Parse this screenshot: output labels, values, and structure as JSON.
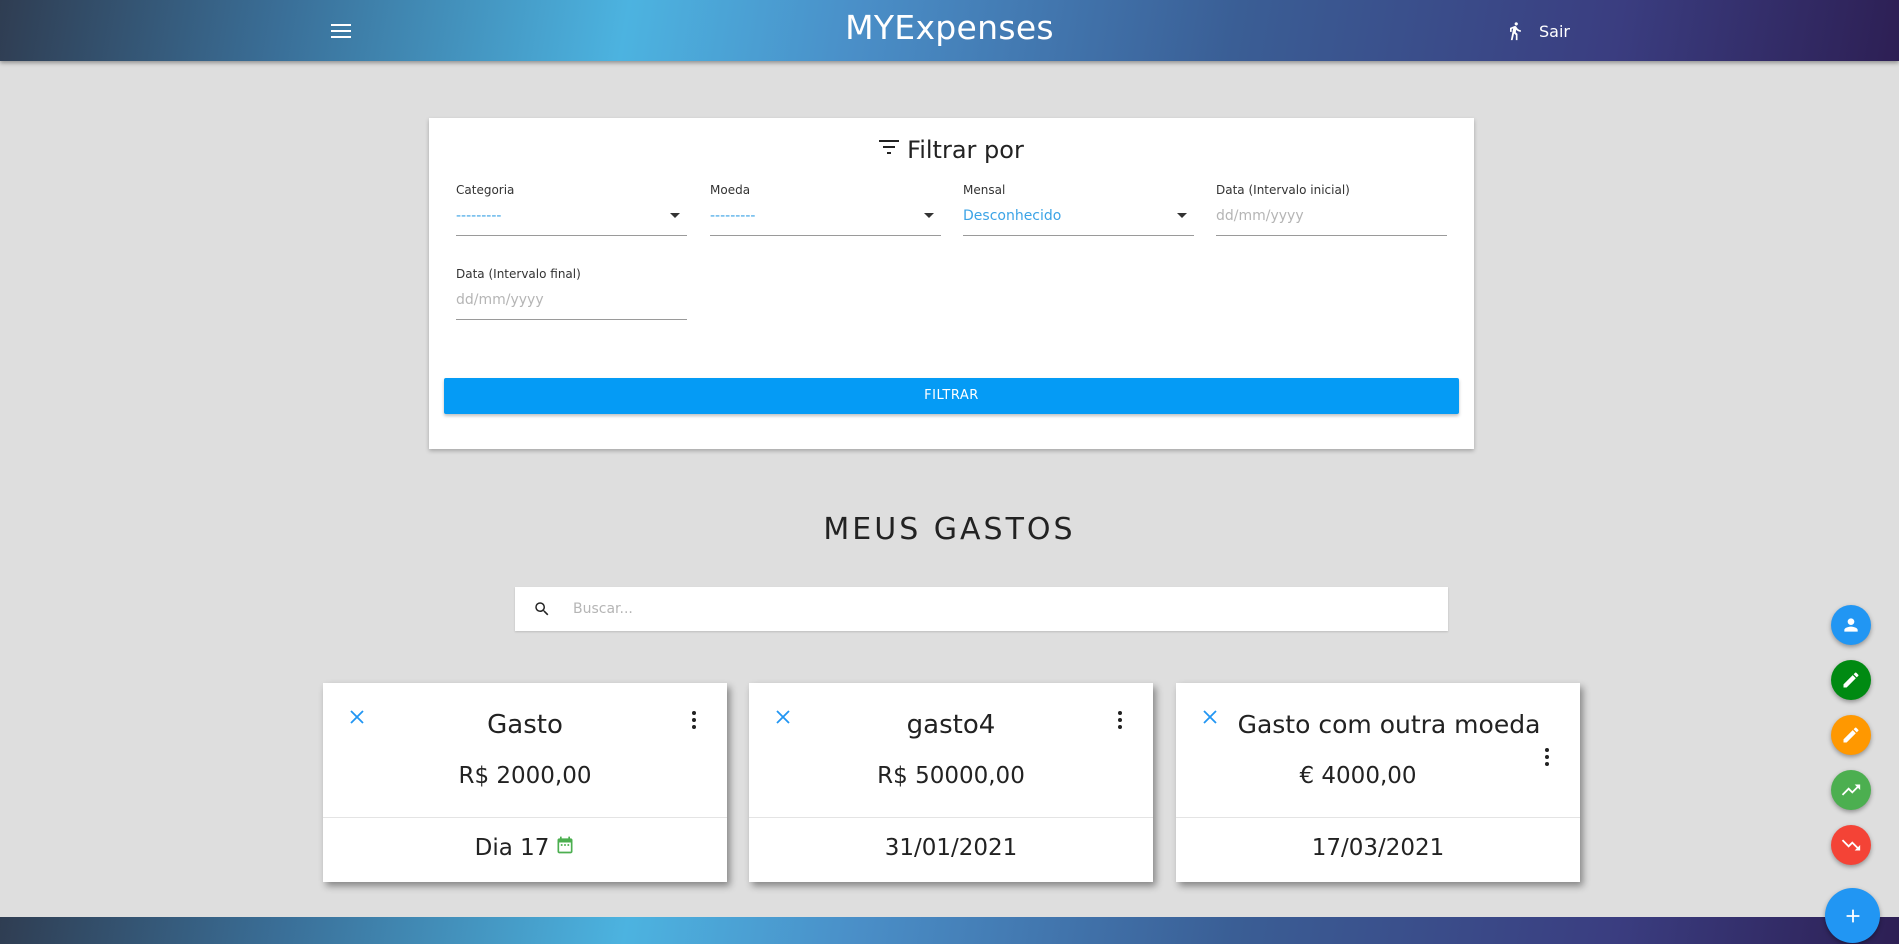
{
  "header": {
    "title": "MYExpenses",
    "logout_label": "Sair",
    "menu_icon": "menu-icon",
    "logout_icon": "walking-person-icon"
  },
  "filter": {
    "title": "Filtrar por",
    "fields": {
      "categoria": {
        "label": "Categoria",
        "value": "---------"
      },
      "moeda": {
        "label": "Moeda",
        "value": "---------"
      },
      "mensal": {
        "label": "Mensal",
        "value": "Desconhecido"
      },
      "data_inicial": {
        "label": "Data (Intervalo inicial)",
        "placeholder": "dd/mm/yyyy"
      },
      "data_final": {
        "label": "Data (Intervalo final)",
        "placeholder": "dd/mm/yyyy"
      }
    },
    "button_label": "FILTRAR"
  },
  "expenses": {
    "title": "MEUS GASTOS",
    "search_placeholder": "Buscar...",
    "cards": [
      {
        "title": "Gasto",
        "amount": "R$ 2000,00",
        "date": "Dia 17",
        "recurring": true
      },
      {
        "title": "gasto4",
        "amount": "R$ 50000,00",
        "date": "31/01/2021",
        "recurring": false
      },
      {
        "title": "Gasto com outra moeda",
        "amount": "€ 4000,00",
        "date": "17/03/2021",
        "recurring": false
      }
    ]
  },
  "fab_menu": [
    {
      "name": "profile",
      "icon": "person-icon",
      "color": "#2196f3"
    },
    {
      "name": "edit-green",
      "icon": "pencil-icon",
      "color": "#008a12"
    },
    {
      "name": "edit-orange",
      "icon": "pencil-icon",
      "color": "#ff9800"
    },
    {
      "name": "income",
      "icon": "trending-up-icon",
      "color": "#4caf50"
    },
    {
      "name": "expense",
      "icon": "trending-down-icon",
      "color": "#f44336"
    },
    {
      "name": "add",
      "icon": "plus-icon",
      "color": "#2196f3"
    }
  ],
  "colors": {
    "accent": "#059bf5",
    "link_value": "#3ba3e6",
    "background": "#dedede"
  }
}
